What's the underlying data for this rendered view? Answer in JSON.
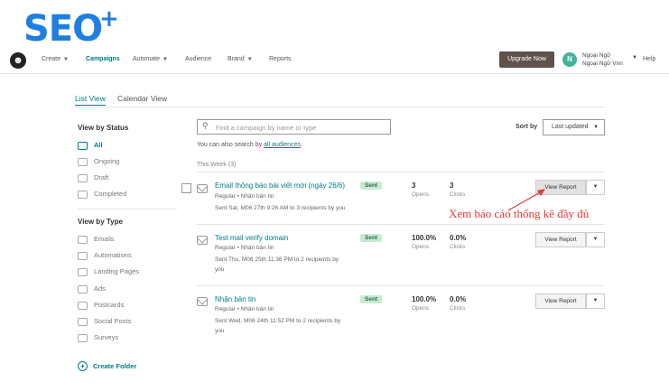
{
  "brand": {
    "logo_text": "SEO",
    "logo_plus": "+"
  },
  "nav": {
    "items": [
      {
        "label": "Create",
        "caret": true
      },
      {
        "label": "Campaigns",
        "active": true
      },
      {
        "label": "Automate",
        "caret": true
      },
      {
        "label": "Audience"
      },
      {
        "label": "Brand",
        "caret": true
      },
      {
        "label": "Reports"
      }
    ],
    "upgrade": "Upgrade Now",
    "avatar_letter": "N",
    "account_line1": "Ngoại Ngữ",
    "account_line2": "Ngoại Ngữ Vnn",
    "help": "Help"
  },
  "tabs": [
    {
      "label": "List View",
      "active": true
    },
    {
      "label": "Calendar View"
    }
  ],
  "sidebar": {
    "status_title": "View by Status",
    "status_items": [
      {
        "label": "All",
        "active": true,
        "icon": "all-icon"
      },
      {
        "label": "Ongoing",
        "icon": "ongoing-icon"
      },
      {
        "label": "Draft",
        "icon": "draft-icon"
      },
      {
        "label": "Completed",
        "icon": "completed-icon"
      }
    ],
    "type_title": "View by Type",
    "type_items": [
      {
        "label": "Emails",
        "icon": "email-icon"
      },
      {
        "label": "Automations",
        "icon": "automation-icon"
      },
      {
        "label": "Landing Pages",
        "icon": "landing-page-icon"
      },
      {
        "label": "Ads",
        "icon": "ads-icon"
      },
      {
        "label": "Postcards",
        "icon": "postcard-icon"
      },
      {
        "label": "Social Posts",
        "icon": "social-icon"
      },
      {
        "label": "Surveys",
        "icon": "survey-icon"
      }
    ],
    "create_folder": "Create Folder"
  },
  "search": {
    "placeholder": "Find a campaign by name or type",
    "value": "",
    "also_prefix": "You can also search by ",
    "also_link": "all audiences",
    "also_suffix": "."
  },
  "sort": {
    "label": "Sort by",
    "value": "Last updated"
  },
  "list": {
    "group_label": "This Week (3)",
    "view_report": "View Report",
    "campaigns": [
      {
        "title": "Email thông báo bài viết mới (ngày 26/6)",
        "subtitle": "Regular • Nhận bản tin",
        "sent_line1": "Sent Sat, M06 27th 9:26 AM to 3 recipients by you",
        "sent_line2": "",
        "badge": "Sent",
        "opens_value": "3",
        "opens_label": "Opens",
        "clicks_value": "3",
        "clicks_label": "Clicks"
      },
      {
        "title": "Test mail verify domain",
        "subtitle": "Regular • Nhận bản tin",
        "sent_line1": "Sent Thu, M06 25th 11:36 PM to 2 recipients by",
        "sent_line2": "you",
        "badge": "Sent",
        "opens_value": "100.0%",
        "opens_label": "Opens",
        "clicks_value": "0.0%",
        "clicks_label": "Clicks"
      },
      {
        "title": "Nhận bản tin",
        "subtitle": "Regular • Nhận bản tin",
        "sent_line1": "Sent Wed, M06 24th 11:52 PM to 2 recipients by",
        "sent_line2": "you",
        "badge": "Sent",
        "opens_value": "100.0%",
        "opens_label": "Opens",
        "clicks_value": "0.0%",
        "clicks_label": "Clicks"
      }
    ]
  },
  "annotation": "Xem báo cáo thống kê đầy đủ",
  "colors": {
    "accent": "#007c89",
    "brand": "#1f7fe0",
    "annotation": "#e53935"
  }
}
